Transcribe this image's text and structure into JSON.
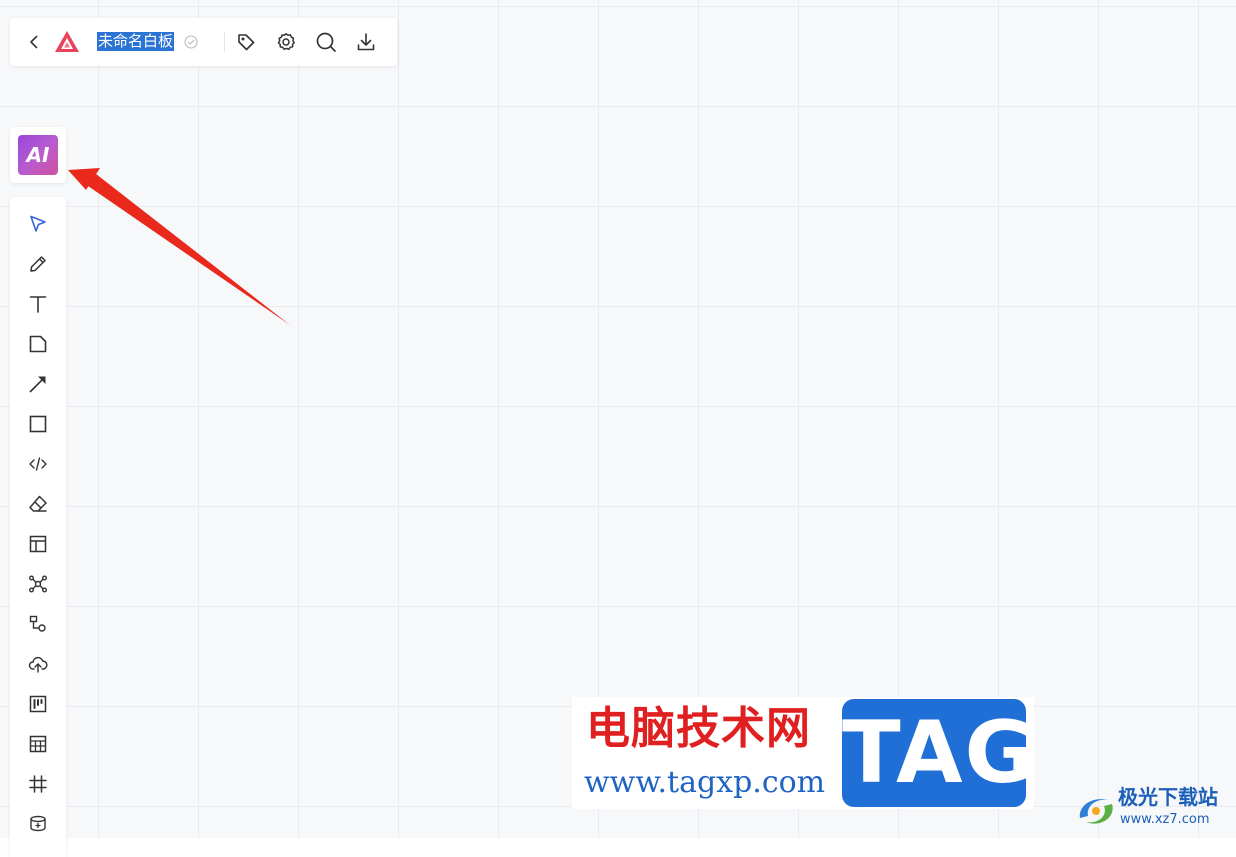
{
  "header": {
    "title": "未命名白板",
    "icons": [
      "back-arrow-icon",
      "app-logo-icon",
      "saved-check-icon",
      "tag-icon",
      "gear-icon",
      "search-icon",
      "download-icon"
    ],
    "logo_color": "#e8435a",
    "title_highlight_color": "#2c74d3"
  },
  "ai_button": {
    "label": "AI",
    "gradient": [
      "#9846d9",
      "#d0539d"
    ]
  },
  "toolbar": {
    "tools": [
      {
        "name": "select-tool",
        "icon": "cursor-icon",
        "active": true
      },
      {
        "name": "pen-tool",
        "icon": "pencil-icon"
      },
      {
        "name": "text-tool",
        "icon": "text-icon"
      },
      {
        "name": "sticky-note-tool",
        "icon": "note-icon"
      },
      {
        "name": "connector-tool",
        "icon": "arrow-icon"
      },
      {
        "name": "shape-tool",
        "icon": "square-icon"
      },
      {
        "name": "code-tool",
        "icon": "code-icon"
      },
      {
        "name": "eraser-tool",
        "icon": "eraser-icon"
      },
      {
        "name": "template-tool",
        "icon": "layout-icon"
      },
      {
        "name": "mindmap-tool",
        "icon": "mindmap-icon"
      },
      {
        "name": "flowchart-tool",
        "icon": "flowchart-icon"
      },
      {
        "name": "upload-tool",
        "icon": "cloud-upload-icon"
      },
      {
        "name": "kanban-tool",
        "icon": "kanban-icon"
      },
      {
        "name": "table-tool",
        "icon": "table-icon"
      },
      {
        "name": "frame-tool",
        "icon": "frame-icon"
      },
      {
        "name": "more-tool",
        "icon": "database-icon"
      }
    ],
    "active_color": "#3a63d8"
  },
  "annotation": {
    "arrow_color": "#e8291c"
  },
  "watermark": {
    "site_name": "电脑技术网",
    "url": "www.tagxp.com",
    "tag": "TAG",
    "tag_color": "#1f6fd6"
  },
  "corner_logo": {
    "name": "极光下载站",
    "url": "www.xz7.com"
  }
}
